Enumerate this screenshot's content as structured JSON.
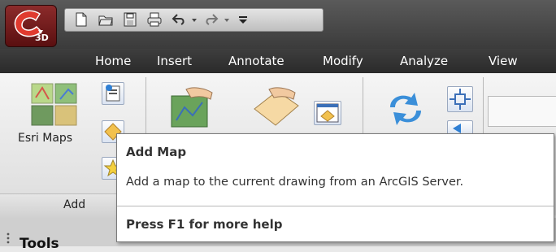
{
  "app": {
    "badge": "3D",
    "icons": [
      "autocad-app-icon",
      "new-icon",
      "open-icon",
      "save-icon",
      "print-icon",
      "undo-icon",
      "redo-icon",
      "qat-dropdown-icon"
    ]
  },
  "menu": {
    "tabs": [
      "Home",
      "Insert",
      "Annotate",
      "Modify",
      "Analyze",
      "View"
    ]
  },
  "ribbon": {
    "esri_maps_label": "Esri Maps",
    "add_panel_title": "Add"
  },
  "tooltip": {
    "title": "Add Map",
    "description": "Add a map to the current drawing from an ArcGIS Server.",
    "help": "Press F1 for more help"
  },
  "bottom": {
    "tools_label": "Tools"
  }
}
